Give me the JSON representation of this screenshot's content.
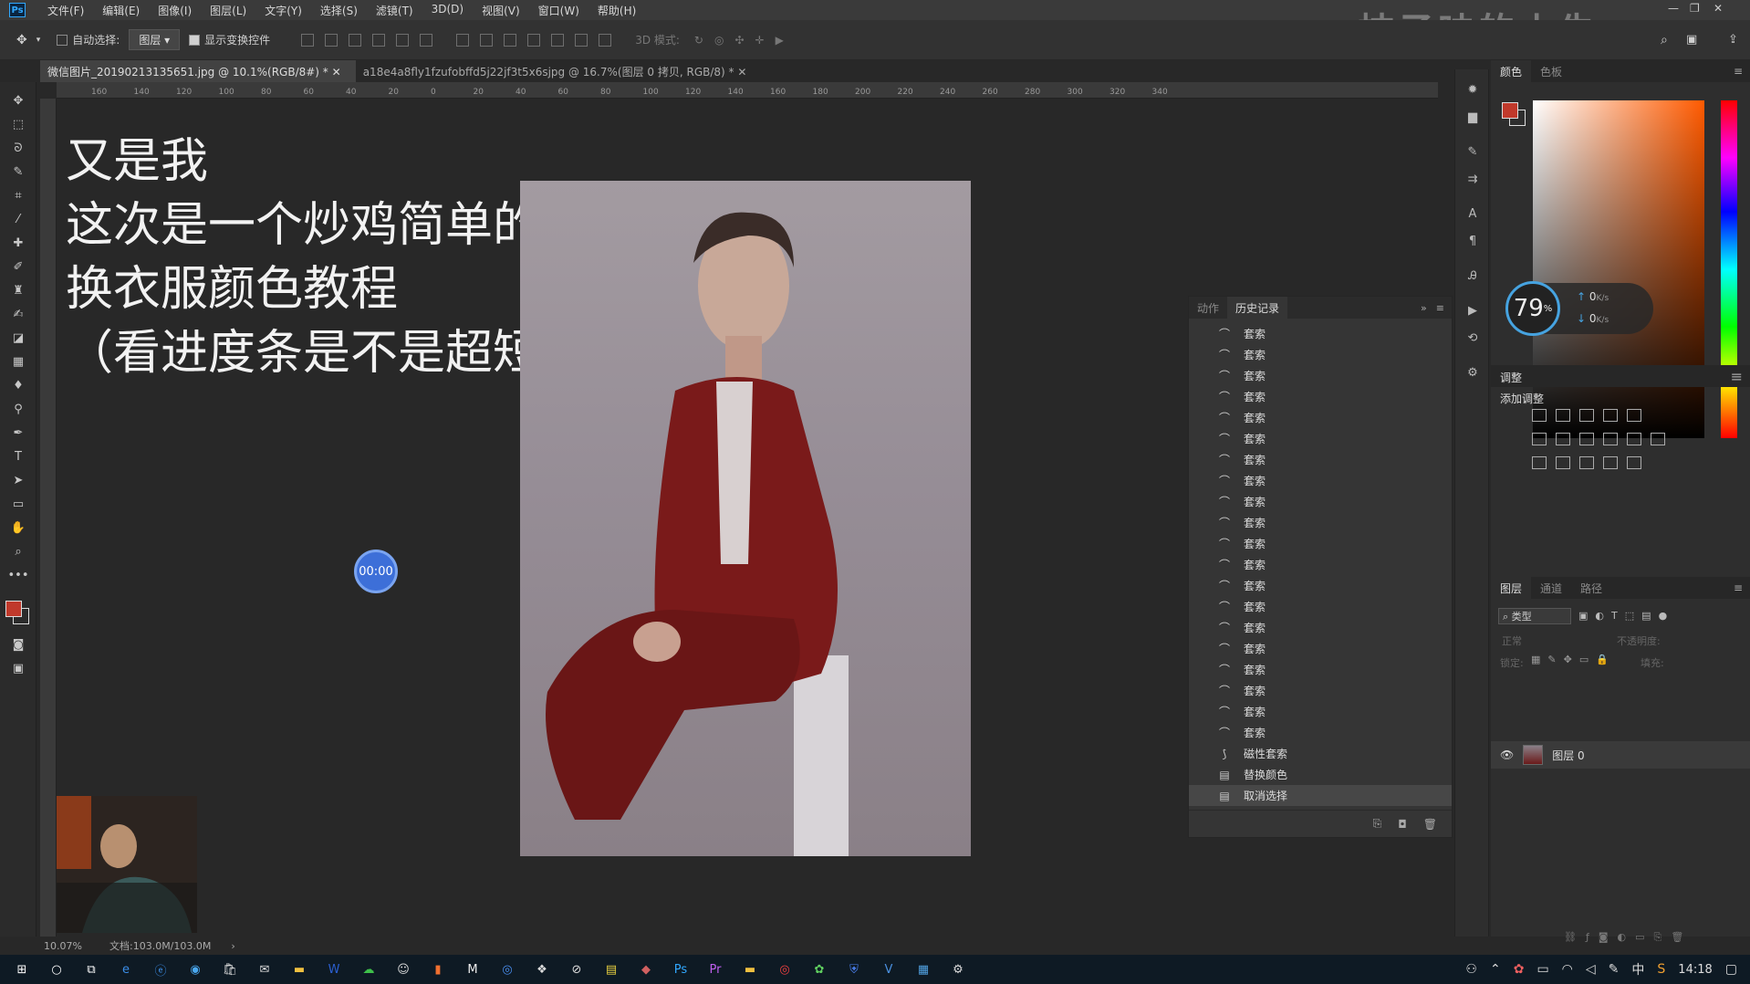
{
  "menubar": {
    "app_icon": "Ps",
    "items": [
      "文件(F)",
      "编辑(E)",
      "图像(I)",
      "图层(L)",
      "文字(Y)",
      "选择(S)",
      "滤镜(T)",
      "3D(D)",
      "视图(V)",
      "窗口(W)",
      "帮助(H)"
    ],
    "watermark": "桔子味的小朱"
  },
  "options_bar": {
    "auto_select_label": "自动选择:",
    "auto_select_value": "图层",
    "show_transform_label": "显示变换控件",
    "mode_3d_label": "3D 模式:"
  },
  "tabs": [
    {
      "label": "微信图片_20190213135651.jpg @ 10.1%(RGB/8#) *",
      "active": true
    },
    {
      "label": "a18e4a8fly1fzufobffd5j22jf3t5x6sjpg @ 16.7%(图层 0 拷贝, RGB/8) *",
      "active": false
    }
  ],
  "ruler_top": [
    "160",
    "140",
    "120",
    "100",
    "80",
    "60",
    "40",
    "20",
    "0",
    "20",
    "40",
    "60",
    "80",
    "100",
    "120",
    "140",
    "160",
    "180",
    "200",
    "220",
    "240",
    "260",
    "280",
    "300",
    "320",
    "340"
  ],
  "canvas": {
    "lines": [
      "又是我",
      "这次是一个炒鸡简单的",
      "换衣服颜色教程",
      "（看进度条是不是超短！"
    ],
    "timer": "00:00"
  },
  "history": {
    "tabs": [
      {
        "label": "动作",
        "active": false
      },
      {
        "label": "历史记录",
        "active": true
      }
    ],
    "rows": [
      {
        "label": "套索",
        "icon": "lasso-icon"
      },
      {
        "label": "套索",
        "icon": "lasso-icon"
      },
      {
        "label": "套索",
        "icon": "lasso-icon"
      },
      {
        "label": "套索",
        "icon": "lasso-icon"
      },
      {
        "label": "套索",
        "icon": "lasso-icon"
      },
      {
        "label": "套索",
        "icon": "lasso-icon"
      },
      {
        "label": "套索",
        "icon": "lasso-icon"
      },
      {
        "label": "套索",
        "icon": "lasso-icon"
      },
      {
        "label": "套索",
        "icon": "lasso-icon"
      },
      {
        "label": "套索",
        "icon": "lasso-icon"
      },
      {
        "label": "套索",
        "icon": "lasso-icon"
      },
      {
        "label": "套索",
        "icon": "lasso-icon"
      },
      {
        "label": "套索",
        "icon": "lasso-icon"
      },
      {
        "label": "套索",
        "icon": "lasso-icon"
      },
      {
        "label": "套索",
        "icon": "lasso-icon"
      },
      {
        "label": "套索",
        "icon": "lasso-icon"
      },
      {
        "label": "套索",
        "icon": "lasso-icon"
      },
      {
        "label": "套索",
        "icon": "lasso-icon"
      },
      {
        "label": "套索",
        "icon": "lasso-icon"
      },
      {
        "label": "套索",
        "icon": "lasso-icon"
      },
      {
        "label": "磁性套索",
        "icon": "magnetic-lasso-icon"
      },
      {
        "label": "替换颜色",
        "icon": "document-icon"
      },
      {
        "label": "取消选择",
        "icon": "document-icon",
        "current": true
      }
    ]
  },
  "right_panels": {
    "color_tabs": [
      {
        "label": "颜色",
        "active": true
      },
      {
        "label": "色板",
        "active": false
      }
    ],
    "net_widget": {
      "percent": "79",
      "percent_unit": "%",
      "up": "0",
      "down": "0",
      "speed_unit": "K/s"
    },
    "adjustments_title": "调整",
    "add_adjustment_label": "添加调整",
    "layers_tabs": [
      {
        "label": "图层",
        "active": true
      },
      {
        "label": "通道",
        "active": false
      },
      {
        "label": "路径",
        "active": false
      }
    ],
    "filter_kind": "类型",
    "blend_mode": "正常",
    "opacity_label": "不透明度:",
    "lock_label": "锁定:",
    "fill_label": "填充:",
    "layer_name": "图层 0"
  },
  "statusbar": {
    "zoom": "10.07%",
    "doc_size": "文档:103.0M/103.0M"
  },
  "taskbar": {
    "clock": "14:18",
    "ime": "中"
  },
  "colors": {
    "foreground": "#c0392b",
    "accent": "#46a3e0"
  }
}
